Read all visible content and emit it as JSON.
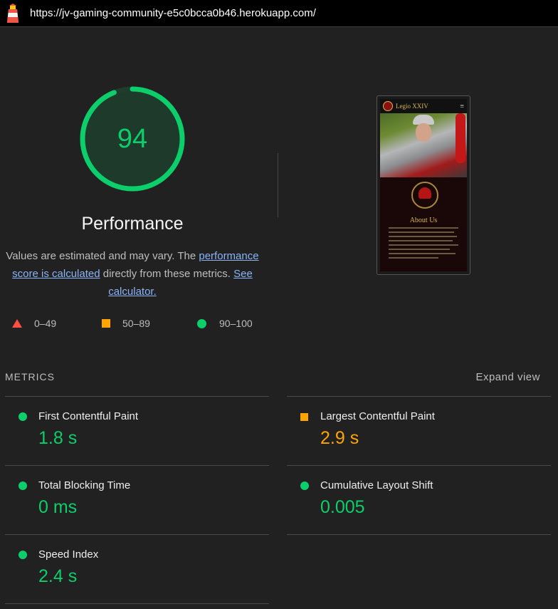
{
  "browser": {
    "url": "https://jv-gaming-community-e5c0bcca0b46.herokuapp.com/"
  },
  "gauge": {
    "score": "94",
    "title": "Performance",
    "color": "#0cce6b"
  },
  "description": {
    "text1": "Values are estimated and may vary. The ",
    "link1": "performance score is calculated",
    "text2": " directly from these metrics. ",
    "link2": "See calculator."
  },
  "legend": [
    {
      "range": "0–49",
      "icon": "red-triangle-icon",
      "color": "#ff4e42"
    },
    {
      "range": "50–89",
      "icon": "orange-square-icon",
      "color": "#ffa400"
    },
    {
      "range": "90–100",
      "icon": "green-circle-icon",
      "color": "#0cce6b"
    }
  ],
  "screenshot": {
    "site_title": "Legio XXIV",
    "menu_glyph": "≡",
    "section_title": "About Us"
  },
  "metrics": {
    "heading": "METRICS",
    "expand_label": "Expand view",
    "items": [
      {
        "label": "First Contentful Paint",
        "value": "1.8 s",
        "status": "good"
      },
      {
        "label": "Largest Contentful Paint",
        "value": "2.9 s",
        "status": "average"
      },
      {
        "label": "Total Blocking Time",
        "value": "0 ms",
        "status": "good"
      },
      {
        "label": "Cumulative Layout Shift",
        "value": "0.005",
        "status": "good"
      },
      {
        "label": "Speed Index",
        "value": "2.4 s",
        "status": "good"
      }
    ]
  }
}
